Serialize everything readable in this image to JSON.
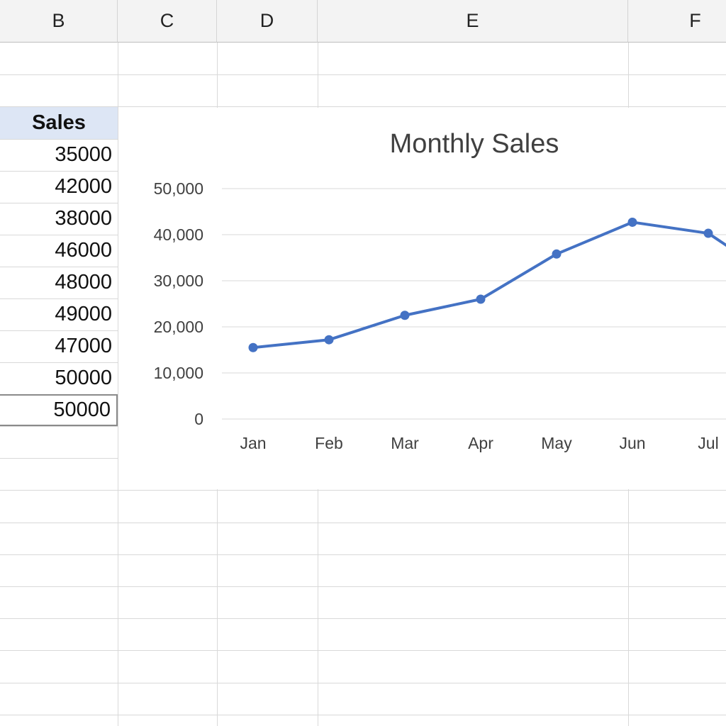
{
  "columns": [
    "B",
    "C",
    "D",
    "E",
    "F"
  ],
  "table": {
    "header": "Sales",
    "values": [
      "35000",
      "42000",
      "38000",
      "46000",
      "48000",
      "49000",
      "47000",
      "50000",
      "50000"
    ]
  },
  "chart_data": {
    "type": "line",
    "title": "Monthly Sales",
    "categories": [
      "Jan",
      "Feb",
      "Mar",
      "Apr",
      "May",
      "Jun",
      "Jul"
    ],
    "series": [
      {
        "values": [
          15500,
          17200,
          22500,
          26000,
          35800,
          42700,
          40300
        ],
        "color": "#4472c4"
      }
    ],
    "yticks": [
      "0",
      "10,000",
      "20,000",
      "30,000",
      "40,000",
      "50,000"
    ],
    "ylim": [
      0,
      50000
    ],
    "grid": true,
    "legend": "none"
  }
}
